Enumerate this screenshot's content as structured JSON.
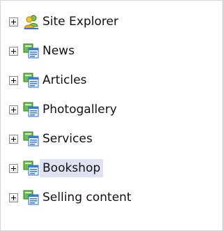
{
  "tree": {
    "items": [
      {
        "label": "Site Explorer",
        "icon": "users-icon",
        "selected": false
      },
      {
        "label": "News",
        "icon": "site-folder-icon",
        "selected": false
      },
      {
        "label": "Articles",
        "icon": "site-folder-icon",
        "selected": false
      },
      {
        "label": "Photogallery",
        "icon": "site-folder-icon",
        "selected": false
      },
      {
        "label": "Services",
        "icon": "site-folder-icon",
        "selected": false
      },
      {
        "label": "Bookshop",
        "icon": "site-folder-icon",
        "selected": true
      },
      {
        "label": "Selling content",
        "icon": "site-folder-icon",
        "selected": false
      }
    ]
  },
  "colors": {
    "selection_bg": "#dfe2f2",
    "expander_border": "#8c8c8c"
  }
}
